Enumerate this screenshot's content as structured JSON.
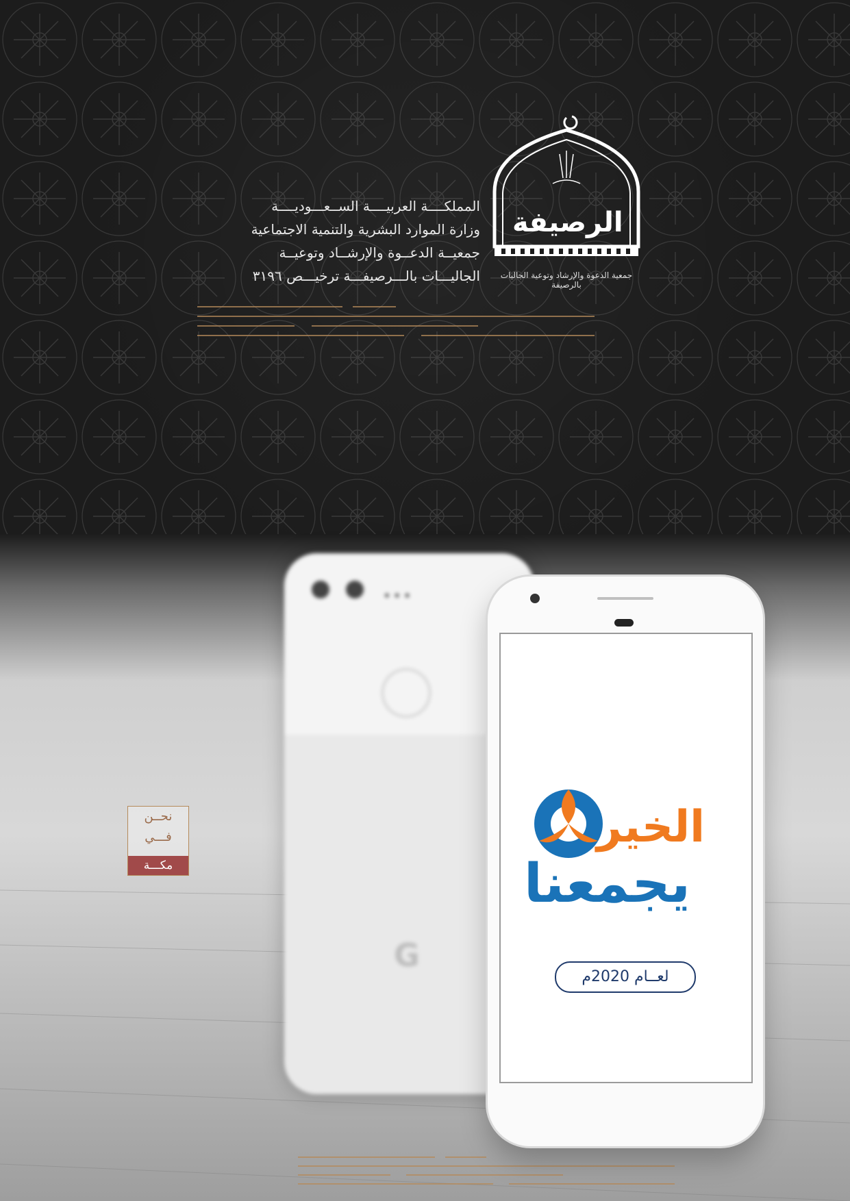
{
  "header": {
    "line1": "المملكــــة العربيــــة الســعـــوديــــة",
    "line2": "وزارة الموارد البشرية والتنمية الاجتماعية",
    "line3": "جمعيــة الدعــوة والإرشــاد وتوعيــة",
    "line4": "الجاليـــات بالـــرصيفـــة ترخيـــص ٣١٩٦"
  },
  "logo": {
    "name": "الرصيفة",
    "subtitle": "جمعية الدعوة والإرشاد وتوعية الجاليات بالرصيفة"
  },
  "phone_screen": {
    "brand_line1": "الخير",
    "brand_line2": "يجمعنا",
    "year_label": "لعــام 2020م"
  },
  "tag": {
    "line1": "نحــن",
    "line2": "فـــي",
    "line3": "مكـــة"
  },
  "colors": {
    "accent_orange": "#f07a1f",
    "accent_blue": "#1a73b8",
    "rule_gold": "#b58a5a",
    "tag_red": "#a14a4a"
  }
}
